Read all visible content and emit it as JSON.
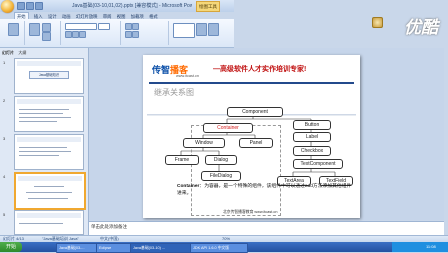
{
  "window": {
    "doc_title": "Java基础(03-10,01,02).pptx [兼容模式] - Microsoft PowerPoint",
    "context_tab": "绘图工具"
  },
  "ribbon": {
    "tabs": [
      "开始",
      "插入",
      "设计",
      "动画",
      "幻灯片放映",
      "审阅",
      "视图",
      "加载项",
      "格式"
    ],
    "active_tab": "开始"
  },
  "left_panel": {
    "tabs": [
      "幻灯片",
      "大纲"
    ],
    "thumbnails": [
      {
        "num": "1",
        "title": "Java基础知识"
      },
      {
        "num": "2",
        "title": ""
      },
      {
        "num": "3",
        "title": ""
      },
      {
        "num": "4",
        "title": ""
      },
      {
        "num": "5",
        "title": ""
      }
    ],
    "selected_index": 4
  },
  "slide": {
    "logo_main": "传智",
    "logo_accent": "播客",
    "logo_url": "www.itcast.cn",
    "slogan": "—高级软件人才实作培训专家!",
    "heading": "继承关系图",
    "nodes": {
      "component": "Component",
      "container": "Container",
      "button": "Button",
      "label": "Label",
      "checkbox": "Checkbox",
      "window": "Window",
      "panel": "Panel",
      "textcomponent": "TextComponent",
      "frame": "Frame",
      "dialog": "Dialog",
      "filedialog": "FileDialog",
      "textarea": "TextArea",
      "textfield": "TextField"
    },
    "caption_term": "Container",
    "caption_text": "：为容器，是一个特殊的组件，该组件中可以通过add方法添加其他组件进来。",
    "footer": "北京传智播客教育 www.itcast.cn"
  },
  "notes": {
    "placeholder": "单击此处添加备注"
  },
  "status_bar": {
    "slide_info": "幻灯片 4/13",
    "theme": "\"Java基础培训 Java\"",
    "language": "中文(中国)",
    "zoom": "70%"
  },
  "taskbar": {
    "start": "开始",
    "buttons": [
      "Java基础(03-...",
      "Eclipse",
      "Java基础(03-10) ...",
      "JDK API 1.6.0 中文版"
    ],
    "clock": "11:08"
  },
  "watermark": "优酷"
}
